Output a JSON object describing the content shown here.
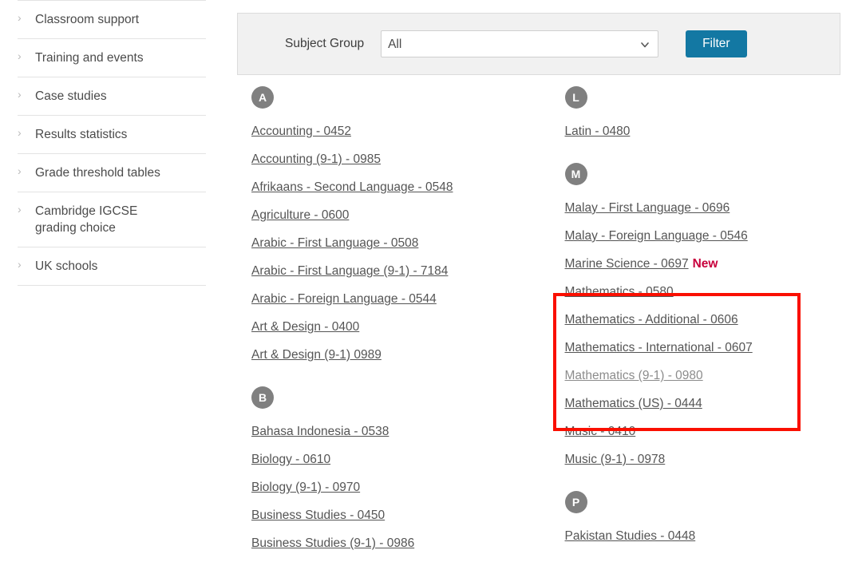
{
  "sidebar": {
    "items": [
      {
        "label": "Classroom support",
        "icon": "chevron-right-icon"
      },
      {
        "label": "Training and events",
        "icon": "chevron-right-icon"
      },
      {
        "label": "Case studies",
        "icon": "chevron-right-icon"
      },
      {
        "label": "Results statistics",
        "icon": "chevron-right-icon"
      },
      {
        "label": "Grade threshold tables",
        "icon": "chevron-right-icon"
      },
      {
        "label": "Cambridge IGCSE\ngrading choice",
        "icon": "chevron-right-icon"
      },
      {
        "label": "UK schools",
        "icon": "chevron-right-icon"
      }
    ]
  },
  "filter": {
    "label": "Subject Group",
    "selected_value": "All",
    "options": [
      "All"
    ],
    "button_label": "Filter",
    "button_color": "#1378a3",
    "panel_background": "#f1f1f1",
    "dropdown_icon": "chevron-down-icon"
  },
  "subjects": {
    "left_column": [
      {
        "letter": "A",
        "items": [
          {
            "label": "Accounting - 0452",
            "state": "normal"
          },
          {
            "label": "Accounting (9-1) - 0985",
            "state": "normal"
          },
          {
            "label": "Afrikaans - Second Language - 0548",
            "state": "normal"
          },
          {
            "label": "Agriculture - 0600",
            "state": "normal"
          },
          {
            "label": "Arabic - First Language - 0508",
            "state": "normal"
          },
          {
            "label": "Arabic - First Language (9-1) - 7184",
            "state": "normal"
          },
          {
            "label": "Arabic - Foreign Language - 0544",
            "state": "normal"
          },
          {
            "label": "Art & Design - 0400",
            "state": "normal"
          },
          {
            "label": "Art & Design (9-1) 0989",
            "state": "normal"
          }
        ]
      },
      {
        "letter": "B",
        "items": [
          {
            "label": "Bahasa Indonesia - 0538",
            "state": "normal"
          },
          {
            "label": "Biology - 0610",
            "state": "normal"
          },
          {
            "label": "Biology (9-1) - 0970",
            "state": "normal"
          },
          {
            "label": "Business Studies - 0450",
            "state": "normal"
          },
          {
            "label": "Business Studies (9-1) - 0986",
            "state": "normal"
          }
        ]
      }
    ],
    "right_column": [
      {
        "letter": "L",
        "items": [
          {
            "label": "Latin - 0480",
            "state": "normal"
          }
        ]
      },
      {
        "letter": "M",
        "items": [
          {
            "label": "Malay - First Language - 0696",
            "state": "normal"
          },
          {
            "label": "Malay - Foreign Language - 0546",
            "state": "normal"
          },
          {
            "label": "Marine Science - 0697",
            "state": "normal",
            "badge": "New"
          },
          {
            "label": "Mathematics - 0580",
            "state": "normal"
          },
          {
            "label": "Mathematics - Additional - 0606",
            "state": "normal"
          },
          {
            "label": "Mathematics - International - 0607",
            "state": "normal"
          },
          {
            "label": "Mathematics (9-1) - 0980",
            "state": "visited"
          },
          {
            "label": "Mathematics (US) - 0444",
            "state": "normal"
          },
          {
            "label": "Music - 0410",
            "state": "normal"
          },
          {
            "label": "Music (9-1) - 0978",
            "state": "normal"
          }
        ]
      },
      {
        "letter": "P",
        "items": [
          {
            "label": "Pakistan Studies - 0448",
            "state": "normal"
          }
        ]
      }
    ]
  },
  "highlight": {
    "color": "#fa0f00",
    "covers": [
      "Mathematics - 0580",
      "Mathematics - Additional - 0606",
      "Mathematics - International - 0607",
      "Mathematics (9-1) - 0980",
      "Mathematics (US) - 0444"
    ]
  }
}
